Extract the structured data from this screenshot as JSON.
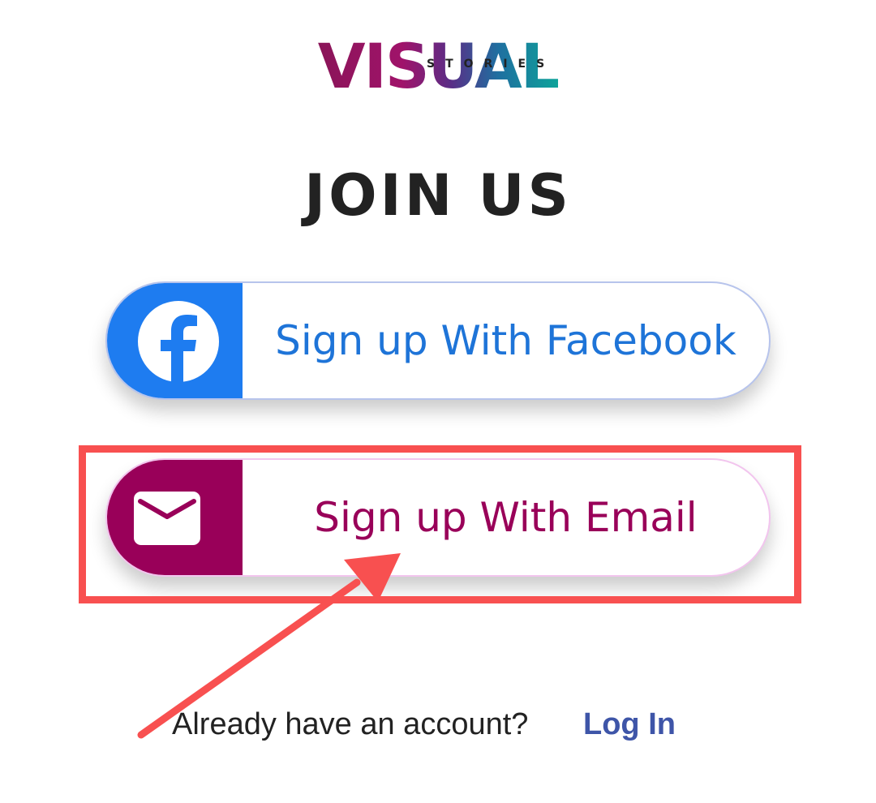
{
  "logo": {
    "name": "VISUAL",
    "tagline": "STORIES"
  },
  "heading": "JOIN US",
  "buttons": {
    "facebook": {
      "label": "Sign up With Facebook",
      "icon": "facebook-icon",
      "color": "#1e7cf0"
    },
    "email": {
      "label": "Sign up With Email",
      "icon": "envelope-icon",
      "color": "#990059"
    }
  },
  "footer": {
    "prompt": "Already have an account?",
    "login_label": "Log In"
  },
  "annotation": {
    "highlight_color": "#f85050"
  }
}
